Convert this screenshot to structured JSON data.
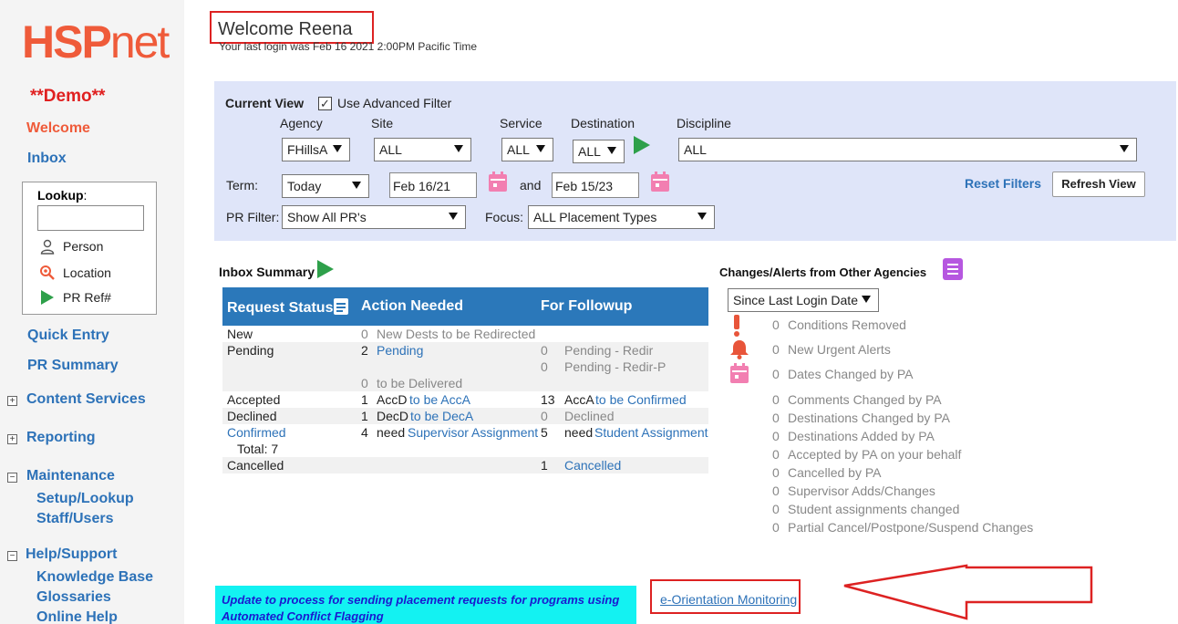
{
  "sidebar": {
    "logo_bold": "HSP",
    "logo_light": "net",
    "demo_label": "**Demo**",
    "welcome": "Welcome",
    "inbox": "Inbox",
    "lookup": {
      "label": "Lookup",
      "colon": ":",
      "input_value": "",
      "person": "Person",
      "location": "Location",
      "pr_ref": "PR Ref#"
    },
    "quick_entry": "Quick Entry",
    "pr_summary": "PR Summary",
    "content_services": "Content Services",
    "reporting": "Reporting",
    "maintenance": "Maintenance",
    "setup_lookup": "Setup/Lookup",
    "staff_users": "Staff/Users",
    "help_support": "Help/Support",
    "knowledge_base": "Knowledge Base",
    "glossaries": "Glossaries",
    "online_help": "Online Help",
    "expand_plus": "+",
    "expand_minus": "−"
  },
  "header": {
    "welcome_title": "Welcome Reena",
    "last_login": "Your last login was Feb 16 2021 2:00PM Pacific Time"
  },
  "filters": {
    "current_view": "Current View",
    "use_advanced_filter": "Use Advanced Filter",
    "checkbox_mark": "✓",
    "agency_label": "Agency",
    "agency_value": "FHillsA",
    "site_label": "Site",
    "site_value": "ALL",
    "service_label": "Service",
    "service_value": "ALL",
    "destination_label": "Destination",
    "destination_value": "ALL",
    "discipline_label": "Discipline",
    "discipline_value": "ALL",
    "term_label": "Term:",
    "term_value": "Today",
    "date_from": "Feb 16/21",
    "and_label": "and",
    "date_to": "Feb 15/23",
    "pr_filter_label": "PR Filter:",
    "pr_filter_value": "Show All PR's",
    "focus_label": "Focus:",
    "focus_value": "ALL Placement Types",
    "reset_filters": "Reset Filters",
    "refresh_view": "Refresh View"
  },
  "inbox_summary": {
    "title": "Inbox Summary",
    "headers": {
      "request_status": "Request Status",
      "action_needed": "Action Needed",
      "for_followup": "For Followup"
    },
    "rows": {
      "new_status": "New",
      "new_action_num": "0",
      "new_action_text": "New Dests to be Redirected",
      "pending_status": "Pending",
      "pending_action_num": "2",
      "pending_action_text": "Pending",
      "pending_follow1_num": "0",
      "pending_follow1_text": "Pending - Redir",
      "pending_follow2_num": "0",
      "pending_follow2_text": "Pending - Redir-P",
      "pending_action2_num": "0",
      "pending_action2_text": "to be Delivered",
      "accepted_status": "Accepted",
      "accepted_action_num": "1",
      "accepted_action_pre": "AccD",
      "accepted_action_link": "to be AccA",
      "accepted_follow_num": "13",
      "accepted_follow_pre": "AccA",
      "accepted_follow_link": "to be Confirmed",
      "declined_status": "Declined",
      "declined_action_num": "1",
      "declined_action_pre": "DecD",
      "declined_action_link": "to be DecA",
      "declined_follow_num": "0",
      "declined_follow_text": "Declined",
      "confirmed_status": "Confirmed",
      "confirmed_total": "Total: 7",
      "confirmed_action_num": "4",
      "confirmed_action_pre": "need",
      "confirmed_action_link": "Supervisor Assignment",
      "confirmed_follow_num": "5",
      "confirmed_follow_pre": "need",
      "confirmed_follow_link": "Student Assignment",
      "cancelled_status": "Cancelled",
      "cancelled_follow_num": "1",
      "cancelled_follow_link": "Cancelled"
    }
  },
  "changes_alerts": {
    "title": "Changes/Alerts from Other Agencies",
    "since_value": "Since Last Login Date",
    "items": [
      {
        "count": "0",
        "label": "Conditions Removed"
      },
      {
        "count": "0",
        "label": "New Urgent Alerts"
      },
      {
        "count": "0",
        "label": "Dates Changed by PA"
      },
      {
        "count": "0",
        "label": "Comments Changed by PA"
      },
      {
        "count": "0",
        "label": "Destinations Changed by PA"
      },
      {
        "count": "0",
        "label": "Destinations Added by PA"
      },
      {
        "count": "0",
        "label": "Accepted by PA on your behalf"
      },
      {
        "count": "0",
        "label": "Cancelled by PA"
      },
      {
        "count": "0",
        "label": "Supervisor Adds/Changes"
      },
      {
        "count": "0",
        "label": "Student assignments changed"
      },
      {
        "count": "0",
        "label": "Partial Cancel/Postpone/Suspend Changes"
      }
    ]
  },
  "bottom": {
    "update_notice": "Update to process for sending placement requests for programs using Automated Conflict Flagging",
    "e_orientation": "e-Orientation Monitoring"
  },
  "colors": {
    "brand_orange": "#ef5b3a",
    "link_blue": "#2d72b8",
    "header_blue": "#2b78ba",
    "filter_bg": "#dfe5f9",
    "notice_cyan": "#13f2f2",
    "annotation_red": "#d22"
  }
}
